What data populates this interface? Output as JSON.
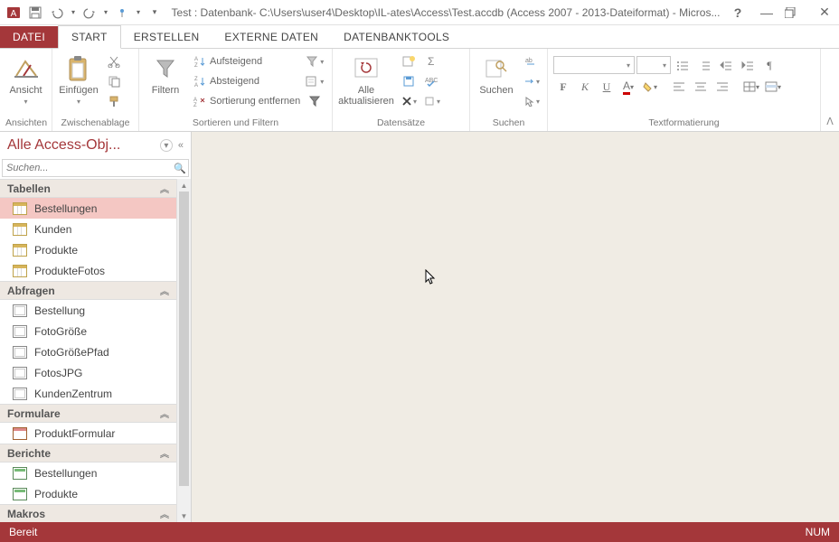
{
  "titlebar": {
    "title": "Test : Datenbank- C:\\Users\\user4\\Desktop\\IL-ates\\Access\\Test.accdb (Access 2007 - 2013-Dateiformat) - Micros..."
  },
  "tabs": {
    "file": "DATEI",
    "start": "START",
    "erstellen": "ERSTELLEN",
    "externe": "EXTERNE DATEN",
    "dbtools": "DATENBANKTOOLS"
  },
  "ribbon": {
    "ansichten": {
      "label": "Ansichten",
      "ansicht": "Ansicht"
    },
    "zwischen": {
      "label": "Zwischenablage",
      "einfuegen": "Einfügen"
    },
    "sort": {
      "label": "Sortieren und Filtern",
      "filtern": "Filtern",
      "auf": "Aufsteigend",
      "ab": "Absteigend",
      "entf": "Sortierung entfernen"
    },
    "daten": {
      "label": "Datensätze",
      "aktual": "Alle\naktualisieren"
    },
    "suchen": {
      "label": "Suchen",
      "suchen": "Suchen"
    },
    "textfmt": {
      "label": "Textformatierung"
    }
  },
  "nav": {
    "title": "Alle Access-Obj...",
    "search_placeholder": "Suchen...",
    "cat_tabellen": "Tabellen",
    "cat_abfragen": "Abfragen",
    "cat_formulare": "Formulare",
    "cat_berichte": "Berichte",
    "cat_makros": "Makros",
    "tabellen": [
      "Bestellungen",
      "Kunden",
      "Produkte",
      "ProdukteFotos"
    ],
    "abfragen": [
      "Bestellung",
      "FotoGröße",
      "FotoGrößePfad",
      "FotosJPG",
      "KundenZentrum"
    ],
    "formulare": [
      "ProduktFormular"
    ],
    "berichte": [
      "Bestellungen",
      "Produkte"
    ]
  },
  "status": {
    "ready": "Bereit",
    "num": "NUM"
  }
}
